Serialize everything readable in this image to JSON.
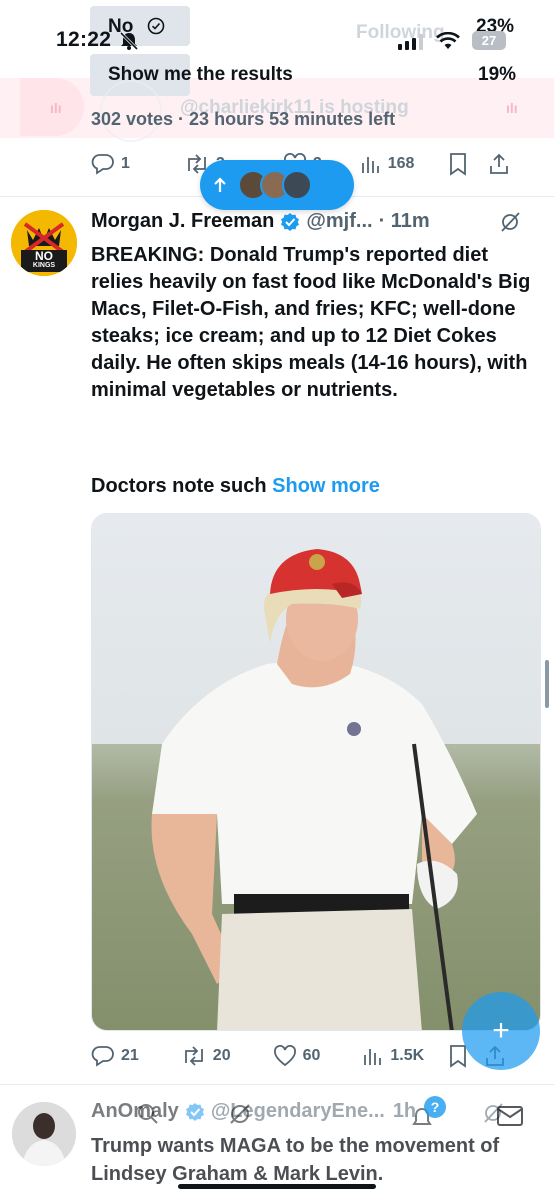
{
  "status_bar": {
    "time": "12:22",
    "battery": "27"
  },
  "poll": {
    "option_no_label": "No",
    "option_no_pct": "23%",
    "option_results_label": "Show me the results",
    "option_results_pct": "19%",
    "ghost_following": "Following",
    "ghost_hosting": "@charliekirk11 is hosting",
    "meta": "302 votes · 23 hours 53 minutes left"
  },
  "prev_actions": {
    "replies": "1",
    "reposts": "2",
    "likes": "2",
    "views": "168"
  },
  "new_posts_pill": {
    "icon": "arrow-up-icon"
  },
  "tweet": {
    "name": "Morgan J. Freeman",
    "handle": "@mjf...",
    "time": "· 11m",
    "avatar_text_top": "NO",
    "avatar_text_bottom": "KINGS",
    "body": "BREAKING: Donald Trump's reported diet relies heavily on fast food like McDonald's Big Macs, Filet-O-Fish, and fries; KFC; well-done steaks; ice cream; and up to 12 Diet Cokes daily. He often skips meals (14-16 hours), with minimal vegetables or nutrients.",
    "body_more": "Doctors note such",
    "show_more": "Show more",
    "replies": "21",
    "reposts": "20",
    "likes": "60",
    "views": "1.5K"
  },
  "fab": {
    "label": "+"
  },
  "next_tweet": {
    "name": "AnOmaly",
    "handle": "@LegendaryEne...",
    "time": "1h",
    "badge": "?",
    "body": "Trump wants MAGA to be the movement of Lindsey Graham & Mark Levin."
  },
  "colors": {
    "accent": "#1d9bf0",
    "text": "#0f1419",
    "muted": "#536471"
  }
}
